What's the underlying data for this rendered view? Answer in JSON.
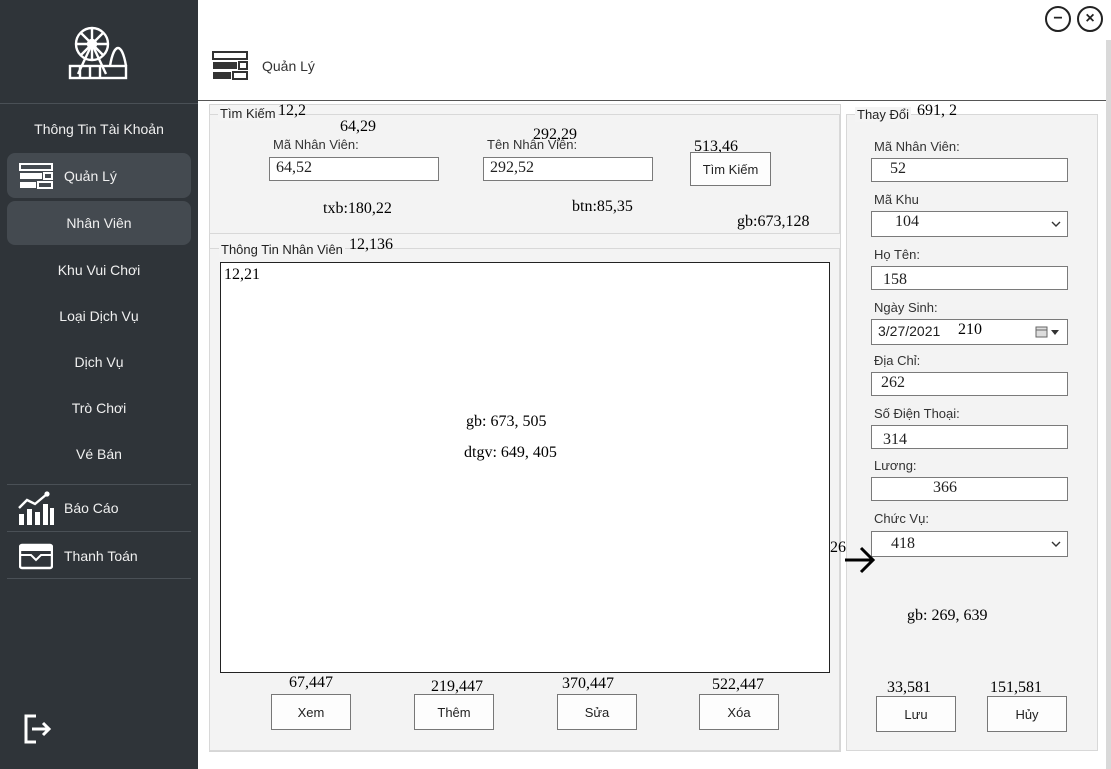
{
  "window": {
    "minimize_label": "−",
    "close_label": "×"
  },
  "header": {
    "title": "Quản Lý",
    "icon": "list-icon"
  },
  "sidebar": {
    "logo_icon": "ferris-wheel-icon",
    "account": "Thông Tin Tài Khoản",
    "manage": "Quản Lý",
    "employees": "Nhân Viên",
    "amusement_areas": "Khu Vui Chơi",
    "service_types": "Loại Dịch Vụ",
    "services": "Dịch Vụ",
    "games": "Trò Chơi",
    "tickets": "Vé Bán",
    "reports": "Báo Cáo",
    "payments": "Thanh Toán",
    "logout_icon": "logout-icon"
  },
  "search": {
    "group_title": "Tìm Kiếm",
    "note_group": "12,2",
    "emp_id_label": "Mã Nhân Viên:",
    "note_emp_id_label": "64,29",
    "emp_id_value": "64,52",
    "emp_name_label": "Tên Nhân Viên:",
    "note_emp_name_label": "292,29",
    "emp_name_value": "292,52",
    "button": "Tìm Kiếm",
    "note_button": "513,46",
    "note_txb": "txb:180,22",
    "note_btn": "btn:85,35",
    "note_gb": "gb:673,128"
  },
  "info": {
    "group_title": "Thông Tin Nhân Viên",
    "note_group": "12,136",
    "grid_note": "12,21",
    "note_gb": "gb: 673, 505",
    "note_dtgv": "dtgv: 649, 405",
    "buttons": {
      "view": "Xem",
      "add": "Thêm",
      "edit": "Sửa",
      "delete": "Xóa"
    },
    "note_view": "67,447",
    "note_add": "219,447",
    "note_edit": "370,447",
    "note_delete": "522,447"
  },
  "edit": {
    "group_title": "Thay Đổi",
    "note_group": "691, 2",
    "emp_id_label": "Mã Nhân Viên:",
    "emp_id_value": "52",
    "area_label": "Mã Khu",
    "area_value": "104",
    "name_label": "Họ Tên:",
    "name_value": "158",
    "dob_label": "Ngày Sinh:",
    "dob_value": "3/27/2021",
    "dob_note": "210",
    "address_label": "Địa Chỉ:",
    "address_value": "262",
    "phone_label": "Số Điện Thoại:",
    "phone_value": "314",
    "salary_label": "Lương:",
    "salary_value": "366",
    "role_label": "Chức Vụ:",
    "role_value": "418",
    "note_arrow": "26",
    "note_gb": "gb: 269, 639",
    "save": "Lưu",
    "cancel": "Hủy",
    "note_save": "33,581",
    "note_cancel": "151,581"
  }
}
